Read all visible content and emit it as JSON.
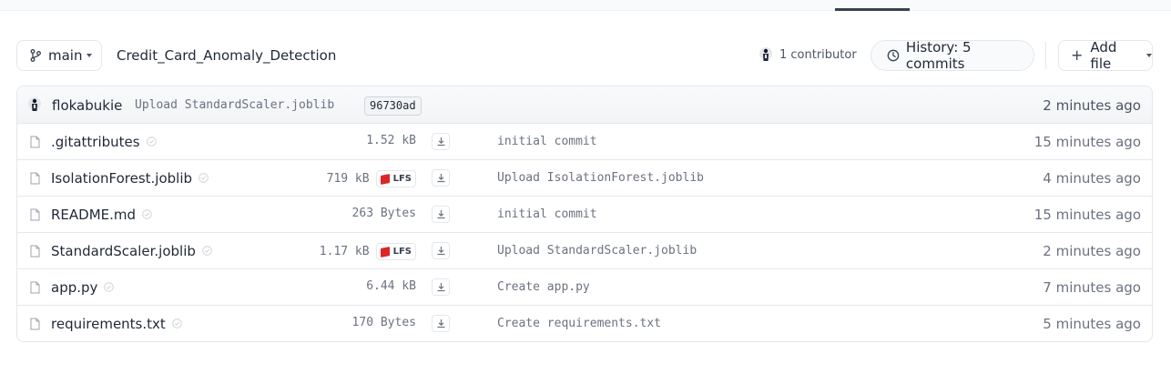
{
  "branch": {
    "name": "main"
  },
  "repo": {
    "path": "Credit_Card_Anomaly_Detection"
  },
  "contributors": {
    "label": "1 contributor"
  },
  "history": {
    "label": "History: 5 commits"
  },
  "add_file": {
    "label": "Add file"
  },
  "last_commit": {
    "author": "flokabukie",
    "message": "Upload StandardScaler.joblib",
    "hash": "96730ad",
    "time": "2 minutes ago"
  },
  "files": [
    {
      "name": ".gitattributes",
      "size": "1.52 kB",
      "lfs": false,
      "commit": "initial commit",
      "time": "15 minutes ago"
    },
    {
      "name": "IsolationForest.joblib",
      "size": "719 kB",
      "lfs": true,
      "lfs_label": "LFS",
      "commit": "Upload IsolationForest.joblib",
      "time": "4 minutes ago"
    },
    {
      "name": "README.md",
      "size": "263 Bytes",
      "lfs": false,
      "commit": "initial commit",
      "time": "15 minutes ago"
    },
    {
      "name": "StandardScaler.joblib",
      "size": "1.17 kB",
      "lfs": true,
      "lfs_label": "LFS",
      "commit": "Upload StandardScaler.joblib",
      "time": "2 minutes ago"
    },
    {
      "name": "app.py",
      "size": "6.44 kB",
      "lfs": false,
      "commit": "Create app.py",
      "time": "7 minutes ago"
    },
    {
      "name": "requirements.txt",
      "size": "170 Bytes",
      "lfs": false,
      "commit": "Create requirements.txt",
      "time": "5 minutes ago"
    }
  ],
  "icons": {
    "branch": "git-branch-icon",
    "history": "clock-icon",
    "file": "file-icon",
    "safe": "shield-check-icon",
    "download": "download-icon",
    "lfs": "lfs-cube-icon"
  },
  "colors": {
    "lfs_cube": "#dc2626",
    "border": "#e5e7eb",
    "muted_text": "#6b7280"
  }
}
